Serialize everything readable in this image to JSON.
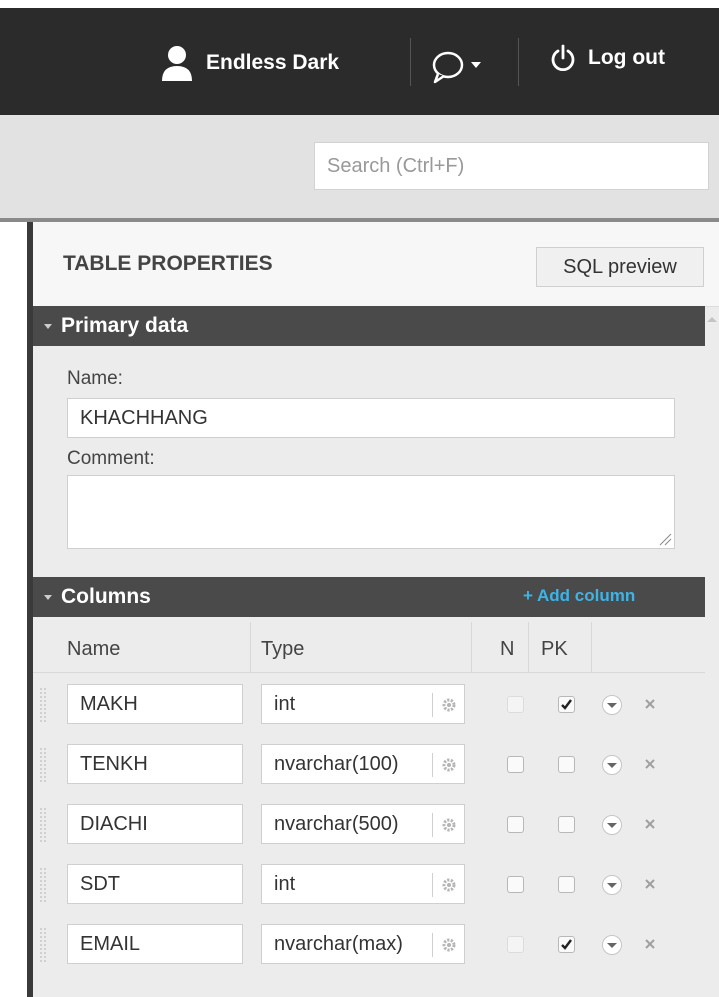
{
  "header": {
    "user_name": "Endless Dark",
    "logout_label": "Log out"
  },
  "search": {
    "placeholder": "Search (Ctrl+F)"
  },
  "panel": {
    "title": "TABLE PROPERTIES",
    "sql_preview_label": "SQL preview"
  },
  "primary_data": {
    "section_title": "Primary data",
    "name_label": "Name:",
    "name_value": "KHACHHANG",
    "comment_label": "Comment:",
    "comment_value": ""
  },
  "columns": {
    "section_title": "Columns",
    "add_column_label": "+ Add column",
    "headers": {
      "name": "Name",
      "type": "Type",
      "n": "N",
      "pk": "PK"
    },
    "rows": [
      {
        "name": "MAKH",
        "type": "int",
        "n": false,
        "n_disabled": true,
        "pk": true
      },
      {
        "name": "TENKH",
        "type": "nvarchar(100)",
        "n": false,
        "n_disabled": false,
        "pk": false
      },
      {
        "name": "DIACHI",
        "type": "nvarchar(500)",
        "n": false,
        "n_disabled": false,
        "pk": false
      },
      {
        "name": "SDT",
        "type": "int",
        "n": false,
        "n_disabled": false,
        "pk": false
      },
      {
        "name": "EMAIL",
        "type": "nvarchar(max)",
        "n": false,
        "n_disabled": true,
        "pk": true
      }
    ]
  },
  "colors": {
    "topbar": "#2b2b2b",
    "section_header": "#4a4a4a",
    "add_column_link": "#3db4e8"
  },
  "icons": [
    "user-icon",
    "chat-bubble-icon",
    "chevron-down-icon",
    "power-icon",
    "gear-icon",
    "menu-circle-icon",
    "close-icon",
    "drag-handle-icon",
    "collapse-caret-icon",
    "resize-handle-icon"
  ]
}
